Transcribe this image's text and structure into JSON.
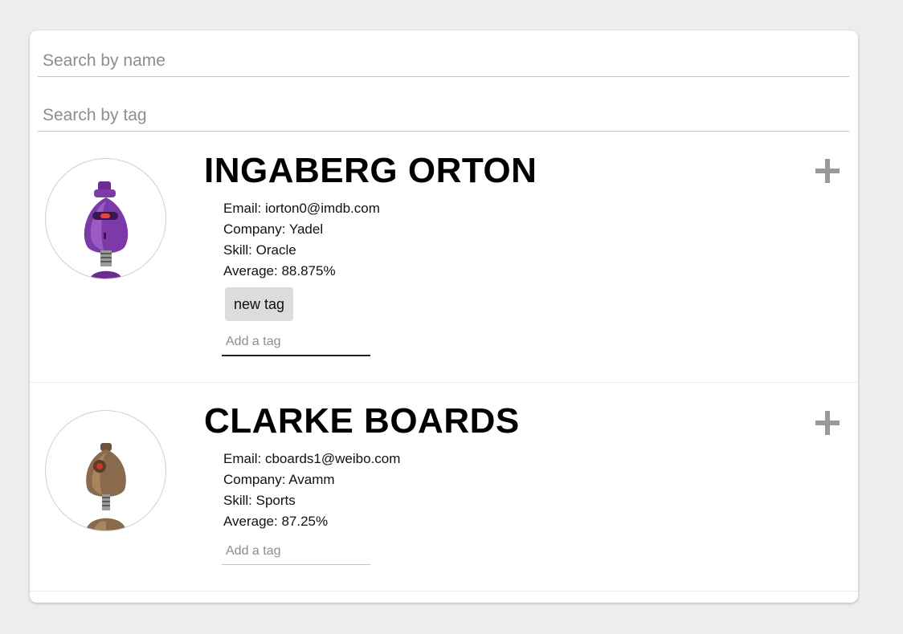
{
  "search": {
    "name_placeholder": "Search by name",
    "tag_placeholder": "Search by tag"
  },
  "students": [
    {
      "name": "INGABERG ORTON",
      "email": "Email: iorton0@imdb.com",
      "company": "Company: Yadel",
      "skill": "Skill: Oracle",
      "average": "Average: 88.875%",
      "tags": [
        "new tag"
      ],
      "tag_placeholder": "Add a tag",
      "avatar_color": "#7b3aa8"
    },
    {
      "name": "CLARKE BOARDS",
      "email": "Email: cboards1@weibo.com",
      "company": "Company: Avamm",
      "skill": "Skill: Sports",
      "average": "Average: 87.25%",
      "tags": [],
      "tag_placeholder": "Add a tag",
      "avatar_color": "#8a6a4c"
    }
  ],
  "colors": {
    "background": "#ededed",
    "card": "#ffffff",
    "expand_icon": "#999999"
  }
}
